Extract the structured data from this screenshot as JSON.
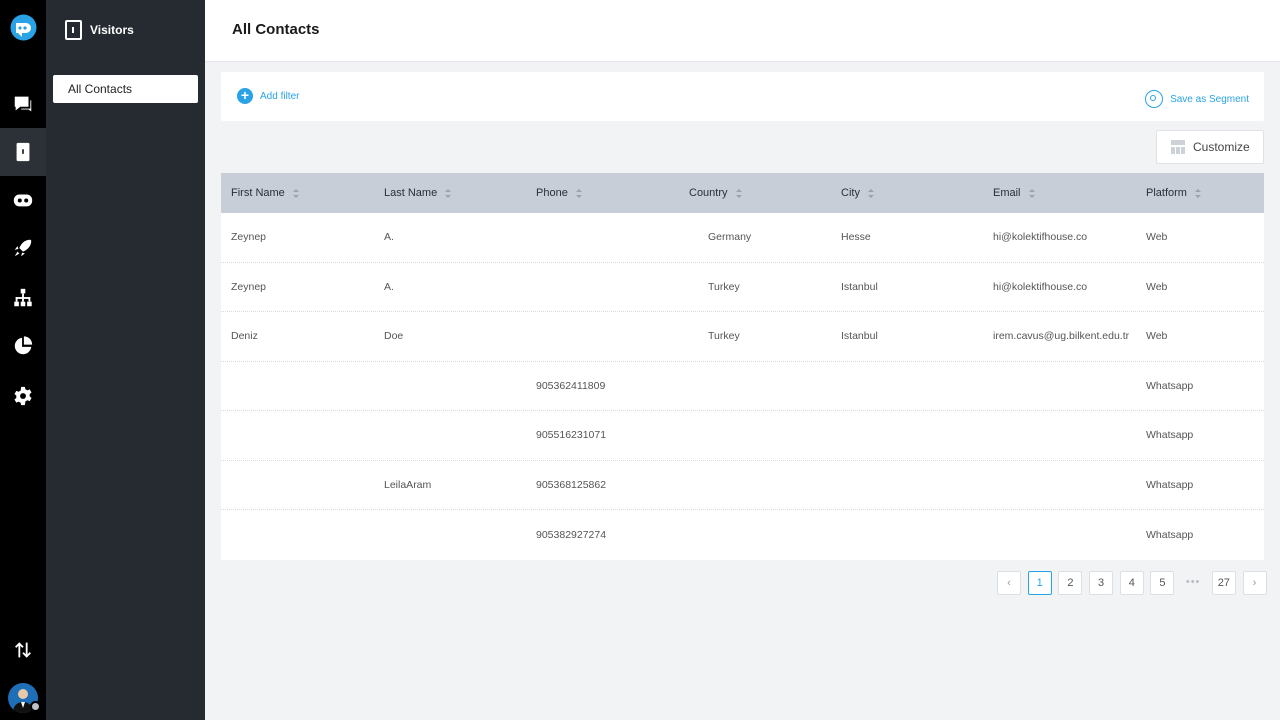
{
  "sidebar": {
    "title": "Visitors",
    "items": [
      {
        "label": "All Contacts",
        "active": true
      }
    ]
  },
  "rail": {
    "icons": [
      "logo-icon",
      "chat-icon",
      "contacts-icon",
      "bot-icon",
      "rocket-icon",
      "hierarchy-icon",
      "pie-chart-icon",
      "gear-icon",
      "sort-arrows-icon",
      "avatar"
    ],
    "active": "contacts-icon"
  },
  "header": {
    "title": "All Contacts"
  },
  "filter": {
    "add_label": "Add filter",
    "save_label": "Save as Segment"
  },
  "toolbar": {
    "customize_label": "Customize"
  },
  "table": {
    "columns": [
      "First Name",
      "Last Name",
      "Phone",
      "Country",
      "City",
      "Email",
      "Platform"
    ],
    "rows": [
      [
        "Zeynep",
        "A.",
        "",
        "Germany",
        "Hesse",
        "hi@kolektifhouse.co",
        "Web"
      ],
      [
        "Zeynep",
        "A.",
        "",
        "Turkey",
        "Istanbul",
        "hi@kolektifhouse.co",
        "Web"
      ],
      [
        "Deniz",
        "Doe",
        "",
        "Turkey",
        "Istanbul",
        "irem.cavus@ug.bilkent.edu.tr",
        "Web"
      ],
      [
        "",
        "",
        "905362411809",
        "",
        "",
        "",
        "Whatsapp"
      ],
      [
        "",
        "",
        "905516231071",
        "",
        "",
        "",
        "Whatsapp"
      ],
      [
        "",
        "LeilaAram",
        "905368125862",
        "",
        "",
        "",
        "Whatsapp"
      ],
      [
        "",
        "",
        "905382927274",
        "",
        "",
        "",
        "Whatsapp"
      ]
    ]
  },
  "pagination": {
    "prev": "‹",
    "pages": [
      "1",
      "2",
      "3",
      "4",
      "5"
    ],
    "ellipsis": "•••",
    "last": "27",
    "next": "›",
    "current": "1"
  },
  "colors": {
    "accent": "#2aa3e6",
    "rail_bg": "#000000",
    "sidebar_bg": "#262b31",
    "table_header_bg": "#c7ced7"
  }
}
